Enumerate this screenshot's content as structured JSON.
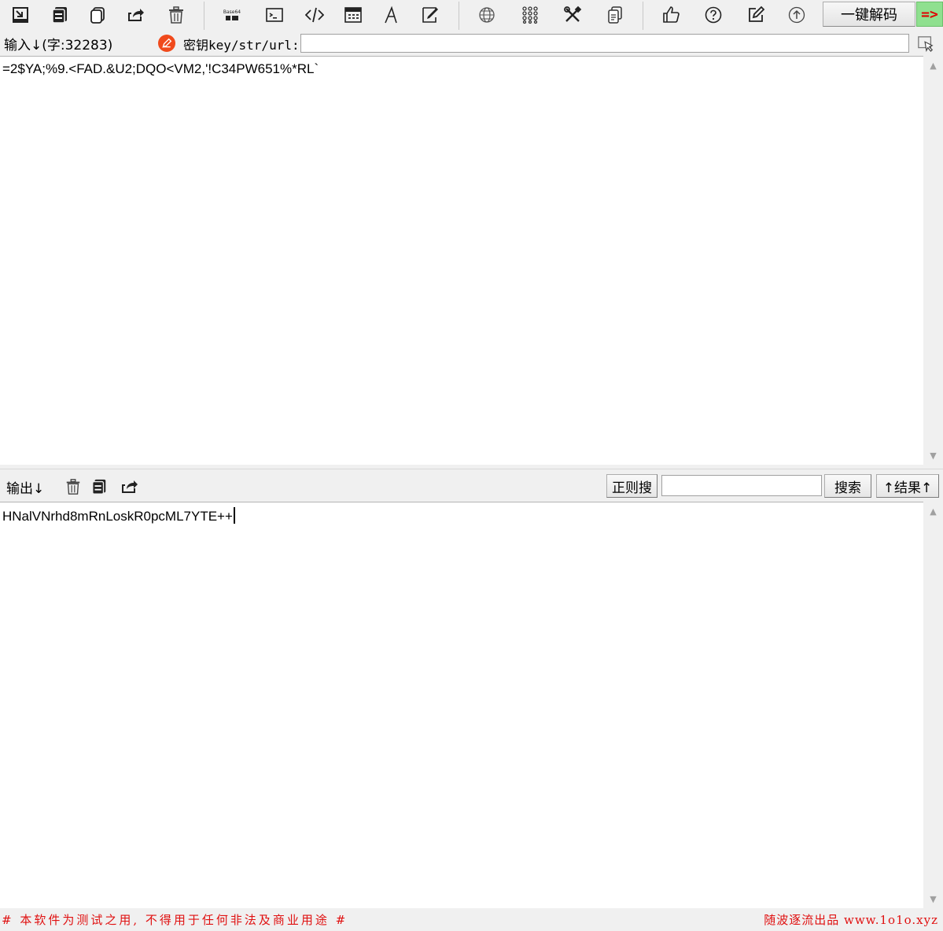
{
  "toolbar": {
    "icons": [
      "import-icon",
      "copy-all-icon",
      "paste-icon",
      "share-icon",
      "delete-icon",
      "base64-icon",
      "terminal-icon",
      "code-icon",
      "calculator-icon",
      "font-icon",
      "sign-icon",
      "globe-icon",
      "grid-icon",
      "tools-icon",
      "document-icon",
      "thumbs-up-icon",
      "help-icon",
      "edit-icon",
      "upload-icon"
    ],
    "base64_icon_text": "Base64",
    "decode_button": "一键解码",
    "arrow_button": "=>"
  },
  "input": {
    "label": "输入↓(字:32283)",
    "key_label": "密钥key/str/url:",
    "key_value": "",
    "content": "=2$YA;%9.<FAD.&U2;DQO<VM2,'!C34PW651%*RL`"
  },
  "output": {
    "label": "输出↓",
    "regex_button": "正则搜",
    "search_value": "",
    "search_button": "搜索",
    "result_button": "↑结果↑",
    "content": "HNalVNrhd8mRnLoskR0pcML7YTE++"
  },
  "footer": {
    "left": "# 本软件为测试之用, 不得用于任何非法及商业用途 #",
    "right": "随波逐流出品 www.1o1o.xyz"
  },
  "colors": {
    "accent_red": "#e01010",
    "key_icon": "#f04a1c",
    "arrow_bg": "#8fe08f"
  }
}
